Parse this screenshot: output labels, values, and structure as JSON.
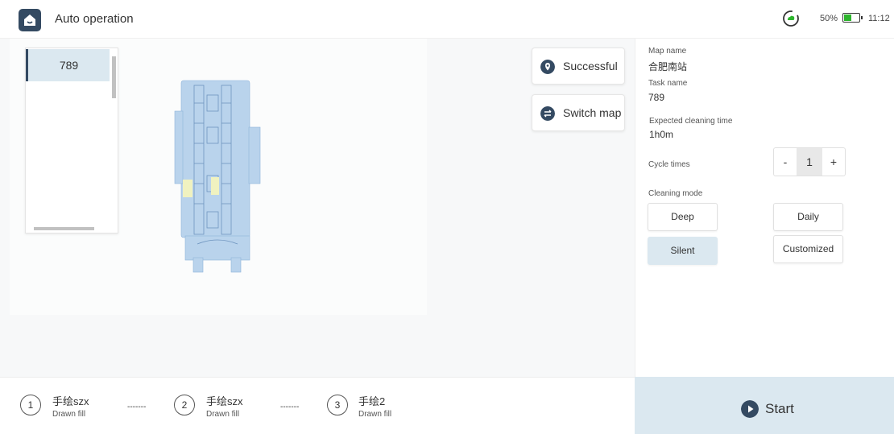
{
  "header": {
    "title": "Auto operation",
    "battery_percent": "50%",
    "battery_level": 0.5,
    "time": "11:12",
    "icons": [
      "home-icon",
      "cloud-sync-icon",
      "battery-icon"
    ]
  },
  "task_list": {
    "items": [
      "789"
    ]
  },
  "map_buttons": {
    "status_label": "Successful",
    "switch_label": "Switch map"
  },
  "info": {
    "map_name_label": "Map name",
    "map_name_value": "合肥南站",
    "task_name_label": "Task name",
    "task_name_value": "789",
    "expected_time_label": "Expected cleaning time",
    "expected_time_value": "1h0m",
    "cycle_label": "Cycle times",
    "cycle_minus": "-",
    "cycle_value": "1",
    "cycle_plus": "+",
    "mode_label": "Cleaning mode",
    "modes": [
      {
        "label": "Deep",
        "active": false
      },
      {
        "label": "Daily",
        "active": false
      },
      {
        "label": "Silent",
        "active": true
      },
      {
        "label": "Customized",
        "active": false
      }
    ]
  },
  "steps": [
    {
      "num": "1",
      "title": "手绘szx",
      "sub": "Drawn fill"
    },
    {
      "num": "2",
      "title": "手绘szx",
      "sub": "Drawn fill"
    },
    {
      "num": "3",
      "title": "手绘2",
      "sub": "Drawn fill"
    }
  ],
  "step_separator": "-------",
  "start_label": "Start",
  "colors": {
    "accent_dark": "#344a62",
    "accent_light": "#dbe8f0",
    "battery_green": "#2db52d",
    "map_fill": "#b9d3ec"
  }
}
